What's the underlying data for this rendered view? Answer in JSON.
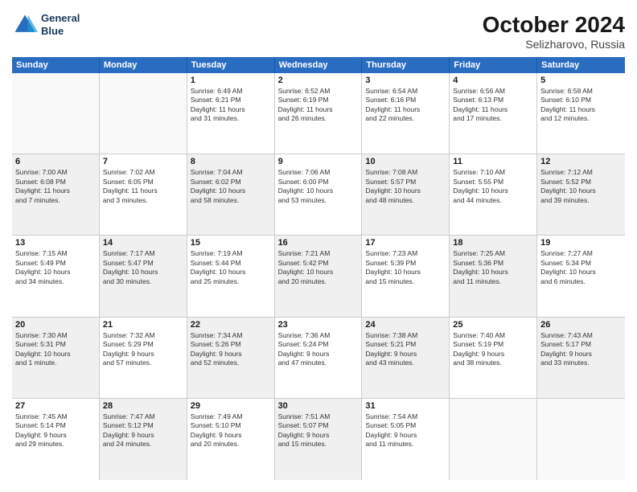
{
  "logo": {
    "line1": "General",
    "line2": "Blue"
  },
  "header": {
    "month": "October 2024",
    "location": "Selizharovo, Russia"
  },
  "weekdays": [
    "Sunday",
    "Monday",
    "Tuesday",
    "Wednesday",
    "Thursday",
    "Friday",
    "Saturday"
  ],
  "rows": [
    [
      {
        "day": "",
        "detail": "",
        "empty": true
      },
      {
        "day": "",
        "detail": "",
        "empty": true
      },
      {
        "day": "1",
        "detail": "Sunrise: 6:49 AM\nSunset: 6:21 PM\nDaylight: 11 hours\nand 31 minutes."
      },
      {
        "day": "2",
        "detail": "Sunrise: 6:52 AM\nSunset: 6:19 PM\nDaylight: 11 hours\nand 26 minutes."
      },
      {
        "day": "3",
        "detail": "Sunrise: 6:54 AM\nSunset: 6:16 PM\nDaylight: 11 hours\nand 22 minutes."
      },
      {
        "day": "4",
        "detail": "Sunrise: 6:56 AM\nSunset: 6:13 PM\nDaylight: 11 hours\nand 17 minutes."
      },
      {
        "day": "5",
        "detail": "Sunrise: 6:58 AM\nSunset: 6:10 PM\nDaylight: 11 hours\nand 12 minutes."
      }
    ],
    [
      {
        "day": "6",
        "detail": "Sunrise: 7:00 AM\nSunset: 6:08 PM\nDaylight: 11 hours\nand 7 minutes.",
        "shaded": true
      },
      {
        "day": "7",
        "detail": "Sunrise: 7:02 AM\nSunset: 6:05 PM\nDaylight: 11 hours\nand 3 minutes."
      },
      {
        "day": "8",
        "detail": "Sunrise: 7:04 AM\nSunset: 6:02 PM\nDaylight: 10 hours\nand 58 minutes.",
        "shaded": true
      },
      {
        "day": "9",
        "detail": "Sunrise: 7:06 AM\nSunset: 6:00 PM\nDaylight: 10 hours\nand 53 minutes."
      },
      {
        "day": "10",
        "detail": "Sunrise: 7:08 AM\nSunset: 5:57 PM\nDaylight: 10 hours\nand 48 minutes.",
        "shaded": true
      },
      {
        "day": "11",
        "detail": "Sunrise: 7:10 AM\nSunset: 5:55 PM\nDaylight: 10 hours\nand 44 minutes."
      },
      {
        "day": "12",
        "detail": "Sunrise: 7:12 AM\nSunset: 5:52 PM\nDaylight: 10 hours\nand 39 minutes.",
        "shaded": true
      }
    ],
    [
      {
        "day": "13",
        "detail": "Sunrise: 7:15 AM\nSunset: 5:49 PM\nDaylight: 10 hours\nand 34 minutes."
      },
      {
        "day": "14",
        "detail": "Sunrise: 7:17 AM\nSunset: 5:47 PM\nDaylight: 10 hours\nand 30 minutes.",
        "shaded": true
      },
      {
        "day": "15",
        "detail": "Sunrise: 7:19 AM\nSunset: 5:44 PM\nDaylight: 10 hours\nand 25 minutes."
      },
      {
        "day": "16",
        "detail": "Sunrise: 7:21 AM\nSunset: 5:42 PM\nDaylight: 10 hours\nand 20 minutes.",
        "shaded": true
      },
      {
        "day": "17",
        "detail": "Sunrise: 7:23 AM\nSunset: 5:39 PM\nDaylight: 10 hours\nand 15 minutes."
      },
      {
        "day": "18",
        "detail": "Sunrise: 7:25 AM\nSunset: 5:36 PM\nDaylight: 10 hours\nand 11 minutes.",
        "shaded": true
      },
      {
        "day": "19",
        "detail": "Sunrise: 7:27 AM\nSunset: 5:34 PM\nDaylight: 10 hours\nand 6 minutes."
      }
    ],
    [
      {
        "day": "20",
        "detail": "Sunrise: 7:30 AM\nSunset: 5:31 PM\nDaylight: 10 hours\nand 1 minute.",
        "shaded": true
      },
      {
        "day": "21",
        "detail": "Sunrise: 7:32 AM\nSunset: 5:29 PM\nDaylight: 9 hours\nand 57 minutes."
      },
      {
        "day": "22",
        "detail": "Sunrise: 7:34 AM\nSunset: 5:26 PM\nDaylight: 9 hours\nand 52 minutes.",
        "shaded": true
      },
      {
        "day": "23",
        "detail": "Sunrise: 7:36 AM\nSunset: 5:24 PM\nDaylight: 9 hours\nand 47 minutes."
      },
      {
        "day": "24",
        "detail": "Sunrise: 7:38 AM\nSunset: 5:21 PM\nDaylight: 9 hours\nand 43 minutes.",
        "shaded": true
      },
      {
        "day": "25",
        "detail": "Sunrise: 7:40 AM\nSunset: 5:19 PM\nDaylight: 9 hours\nand 38 minutes."
      },
      {
        "day": "26",
        "detail": "Sunrise: 7:43 AM\nSunset: 5:17 PM\nDaylight: 9 hours\nand 33 minutes.",
        "shaded": true
      }
    ],
    [
      {
        "day": "27",
        "detail": "Sunrise: 7:45 AM\nSunset: 5:14 PM\nDaylight: 9 hours\nand 29 minutes."
      },
      {
        "day": "28",
        "detail": "Sunrise: 7:47 AM\nSunset: 5:12 PM\nDaylight: 9 hours\nand 24 minutes.",
        "shaded": true
      },
      {
        "day": "29",
        "detail": "Sunrise: 7:49 AM\nSunset: 5:10 PM\nDaylight: 9 hours\nand 20 minutes."
      },
      {
        "day": "30",
        "detail": "Sunrise: 7:51 AM\nSunset: 5:07 PM\nDaylight: 9 hours\nand 15 minutes.",
        "shaded": true
      },
      {
        "day": "31",
        "detail": "Sunrise: 7:54 AM\nSunset: 5:05 PM\nDaylight: 9 hours\nand 11 minutes."
      },
      {
        "day": "",
        "detail": "",
        "empty": true
      },
      {
        "day": "",
        "detail": "",
        "empty": true
      }
    ]
  ]
}
